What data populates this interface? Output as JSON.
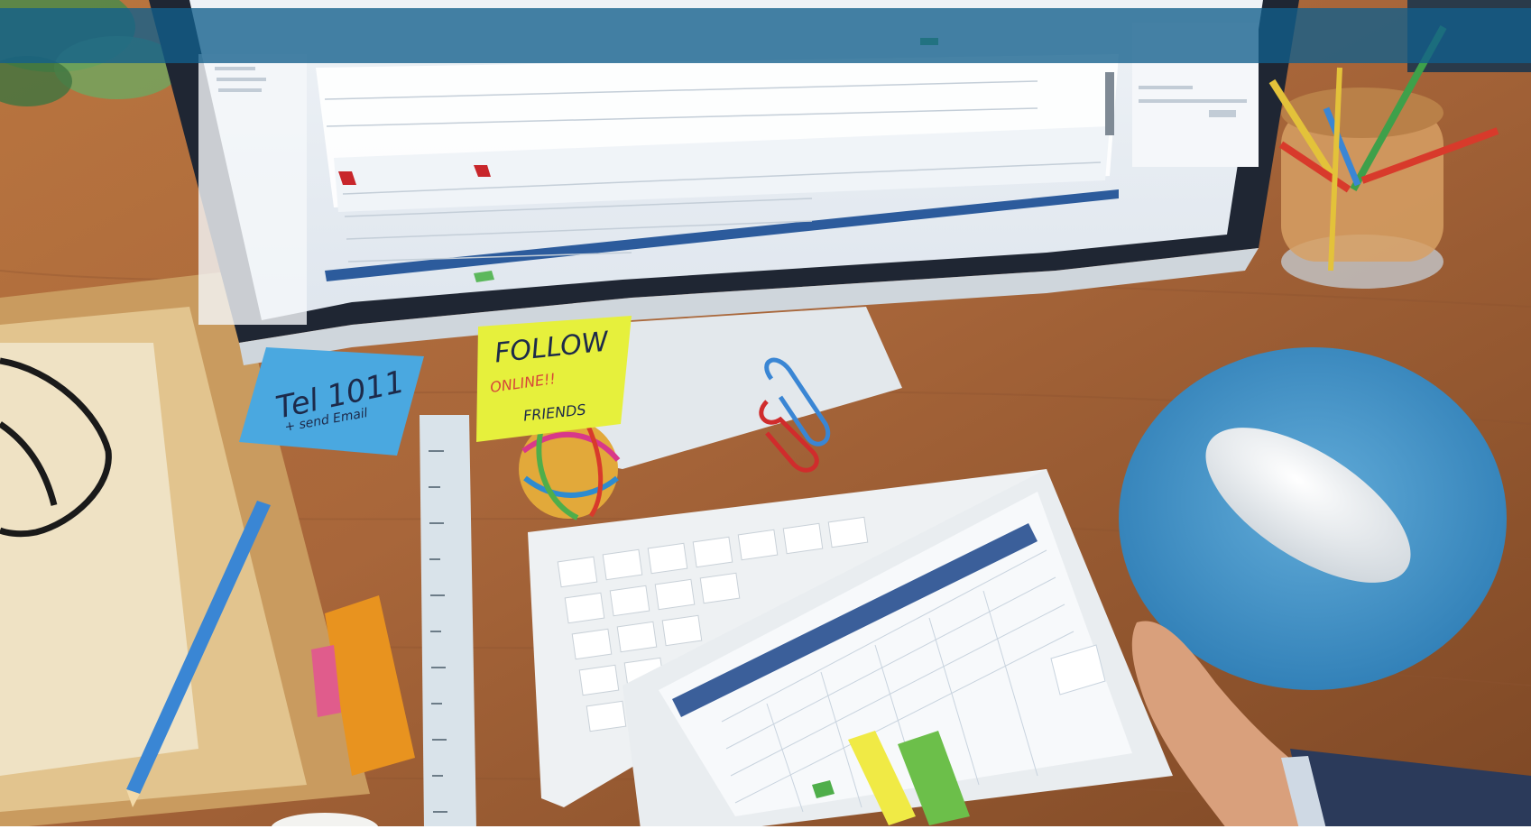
{
  "photo": {
    "sticky_note_blue": {
      "line1": "Tel 1011",
      "line2": "+ send Email"
    },
    "sticky_note_yellow": {
      "line1": "FOLLOW",
      "line2": "ONLINE!!",
      "line3": "FRIENDS"
    },
    "colors": {
      "overlay_band": "#125f8c",
      "desk_wood": "#a8663a",
      "monitor_bezel": "#1f2633",
      "sticky_blue": "#4aa8e0",
      "sticky_yellow": "#e6f03c",
      "mouse_pad": "#3d8fc9",
      "mug_tint": "#d7a064"
    }
  }
}
